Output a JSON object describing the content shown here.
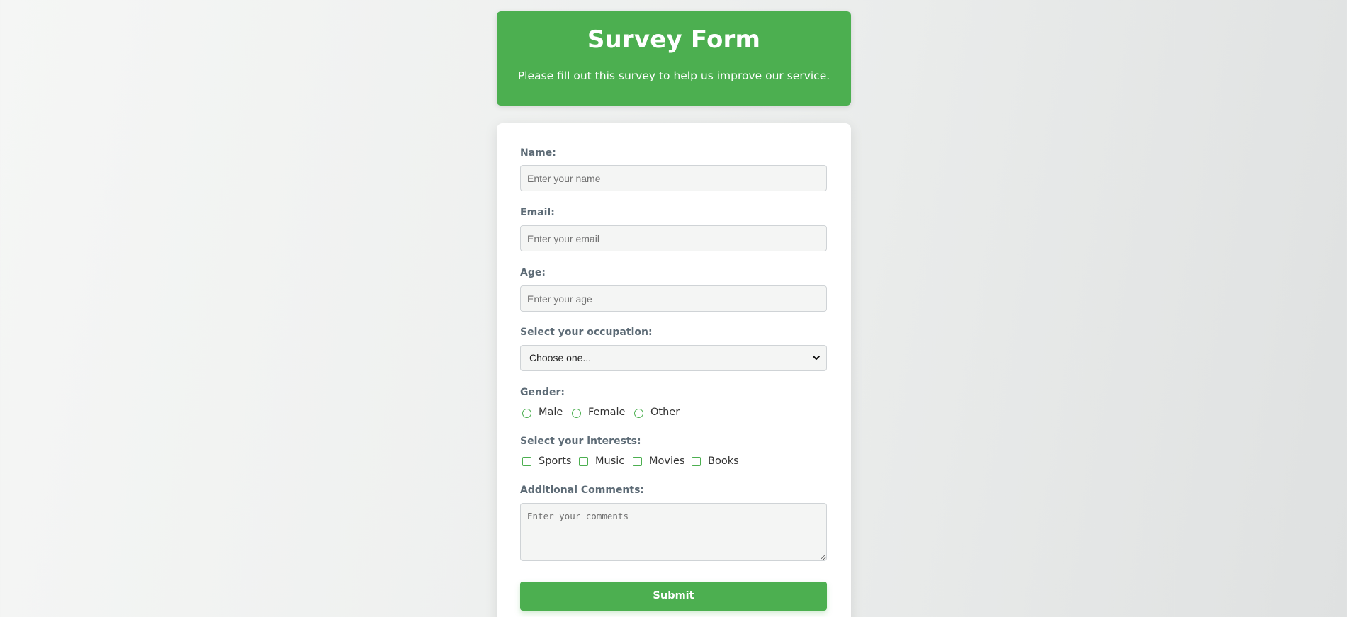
{
  "header": {
    "title": "Survey Form",
    "subtitle": "Please fill out this survey to help us improve our service."
  },
  "form": {
    "name": {
      "label": "Name:",
      "placeholder": "Enter your name",
      "value": ""
    },
    "email": {
      "label": "Email:",
      "placeholder": "Enter your email",
      "value": ""
    },
    "age": {
      "label": "Age:",
      "placeholder": "Enter your age",
      "value": ""
    },
    "occupation": {
      "label": "Select your occupation:",
      "selected": "Choose one...",
      "icon": "chevron-down-icon"
    },
    "gender": {
      "label": "Gender:",
      "options": [
        "Male",
        "Female",
        "Other"
      ]
    },
    "interests": {
      "label": "Select your interests:",
      "options": [
        "Sports",
        "Music",
        "Movies",
        "Books"
      ]
    },
    "comments": {
      "label": "Additional Comments:",
      "placeholder": "Enter your comments",
      "value": ""
    },
    "submit_label": "Submit"
  },
  "colors": {
    "accent": "#4caf50",
    "label": "#5d6b76",
    "field_bg": "#f4f5f4"
  }
}
